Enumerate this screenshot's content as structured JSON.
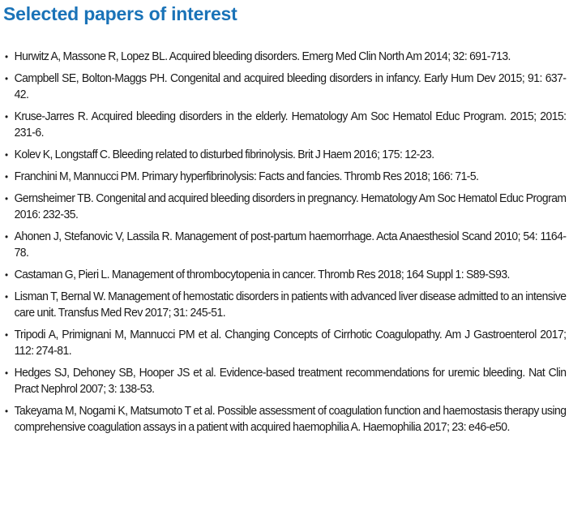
{
  "section": {
    "title": "Selected papers of interest"
  },
  "bullet_glyph": "•",
  "accent_color": "#1a73b8",
  "references": [
    "Hurwitz A, Massone R, Lopez BL. Acquired bleeding disorders. Emerg Med Clin North Am 2014; 32: 691-713.",
    "Campbell SE, Bolton-Maggs PH. Congenital and acquired bleeding disorders in infancy. Early Hum Dev 2015; 91: 637-42.",
    "Kruse-Jarres R. Acquired bleeding disorders in the elderly. Hematology Am Soc Hematol Educ Program. 2015; 2015: 231-6.",
    "Kolev K, Longstaff C. Bleeding related to disturbed fibrinolysis. Brit J Haem 2016; 175: 12-23.",
    "Franchini M, Mannucci PM. Primary hyperfibrinolysis: Facts and fancies. Thromb Res 2018; 166: 71-5.",
    "Gernsheimer TB. Congenital and acquired bleeding disorders in pregnancy. Hematology Am Soc Hematol Educ Program 2016: 232-35.",
    "Ahonen J, Stefanovic V, Lassila R. Management of post-partum haemorrhage. Acta Anaesthesiol Scand 2010; 54: 1164-78.",
    "Castaman G, Pieri L. Management of thrombocytopenia in cancer. Thromb Res 2018; 164 Suppl 1: S89-S93.",
    "Lisman T, Bernal W. Management of hemostatic disorders in patients with advanced liver disease admitted to an intensive care unit. Transfus Med Rev 2017; 31: 245-51.",
    "Tripodi A, Primignani M, Mannucci PM et al. Changing Concepts of Cirrhotic Coagulopathy. Am J Gastroenterol 2017; 112: 274-81.",
    "Hedges SJ, Dehoney SB, Hooper JS et al. Evidence-based treatment recommendations for uremic bleeding. Nat Clin Pract Nephrol 2007; 3: 138-53.",
    "Takeyama M, Nogami K, Matsumoto T et al. Possible assessment of coagulation function and haemostasis therapy using comprehensive coagulation assays in a patient with acquired haemophilia A. Haemophilia 2017; 23: e46-e50."
  ]
}
